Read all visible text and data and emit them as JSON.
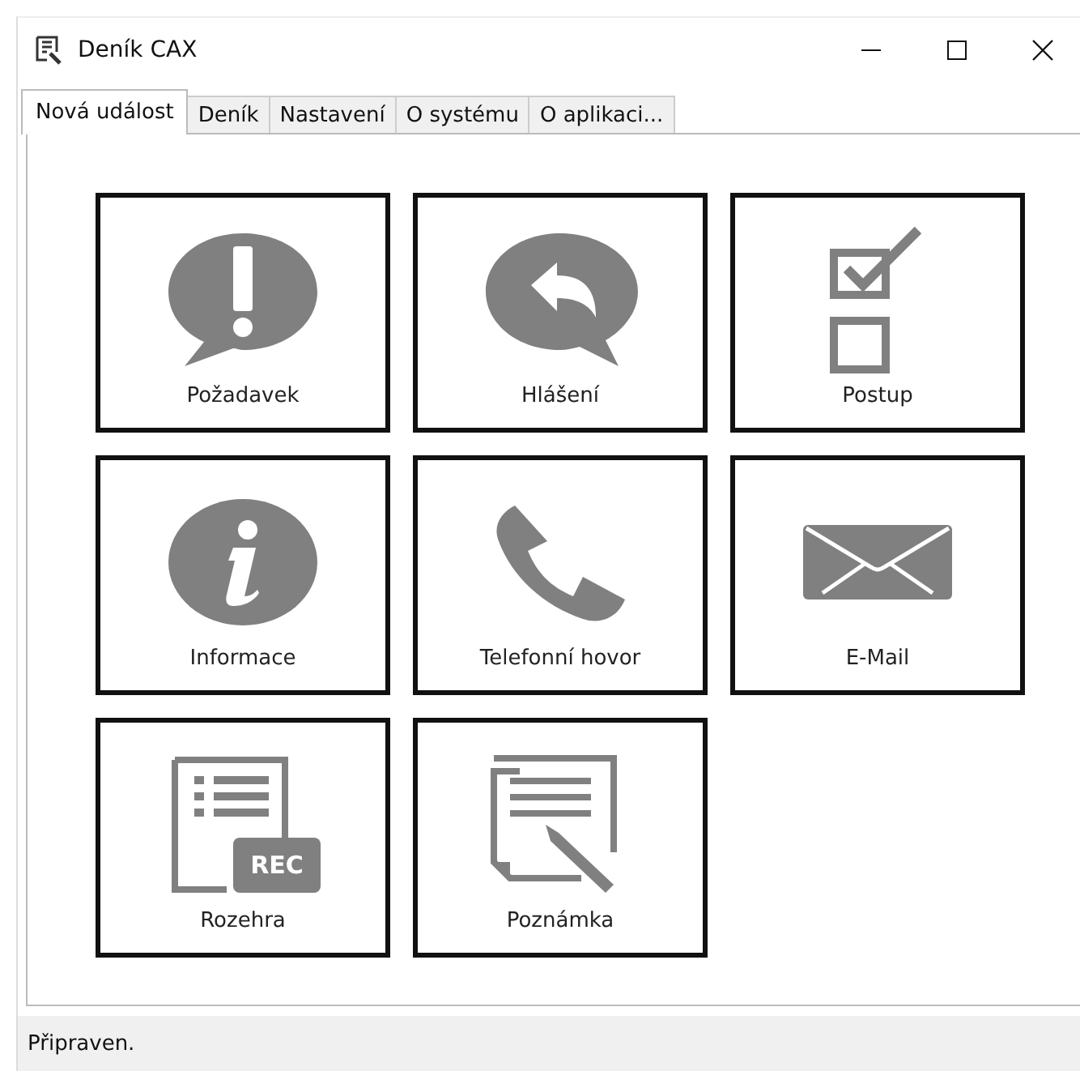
{
  "window": {
    "title": "Deník CAX"
  },
  "tabs": [
    {
      "label": "Nová událost",
      "selected": true
    },
    {
      "label": "Deník",
      "selected": false
    },
    {
      "label": "Nastavení",
      "selected": false
    },
    {
      "label": "O systému",
      "selected": false
    },
    {
      "label": "O aplikaci...",
      "selected": false
    }
  ],
  "tiles": [
    {
      "kind": "alert",
      "label": "Požadavek"
    },
    {
      "kind": "reply",
      "label": "Hlášení"
    },
    {
      "kind": "checklist",
      "label": "Postup"
    },
    {
      "kind": "info",
      "label": "Informace"
    },
    {
      "kind": "phone",
      "label": "Telefonní hovor"
    },
    {
      "kind": "mail",
      "label": "E-Mail"
    },
    {
      "kind": "record",
      "label": "Rozehra",
      "icon_text": "REC"
    },
    {
      "kind": "note",
      "label": "Poznámka"
    }
  ],
  "status_bar": {
    "text": "Připraven."
  }
}
